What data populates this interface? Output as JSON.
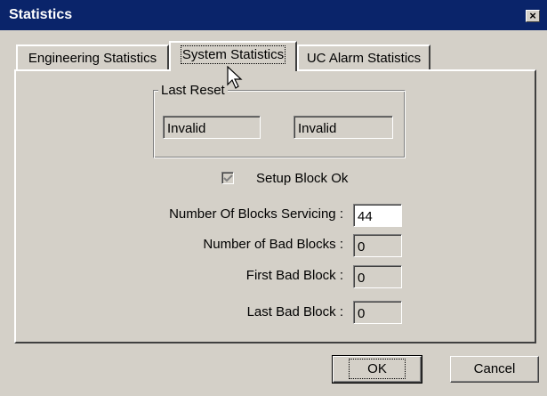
{
  "window": {
    "title": "Statistics",
    "close_glyph": "×"
  },
  "tabs": [
    {
      "label": "Engineering Statistics",
      "active": false
    },
    {
      "label": "System Statistics",
      "active": true
    },
    {
      "label": "UC Alarm Statistics",
      "active": false
    }
  ],
  "last_reset": {
    "label": "Last Reset",
    "values": [
      "Invalid",
      "Invalid"
    ]
  },
  "setup_block": {
    "label": "Setup Block Ok",
    "checked": true,
    "disabled": true
  },
  "stats": [
    {
      "label": "Number Of Blocks Servicing :",
      "value": "44"
    },
    {
      "label": "Number of Bad Blocks :",
      "value": "0"
    },
    {
      "label": "First Bad Block :",
      "value": "0"
    },
    {
      "label": "Last Bad Block :",
      "value": "0"
    }
  ],
  "buttons": {
    "ok": "OK",
    "cancel": "Cancel"
  },
  "icons": {
    "close": "close-icon",
    "check": "check-icon",
    "cursor": "arrow-cursor-icon"
  }
}
